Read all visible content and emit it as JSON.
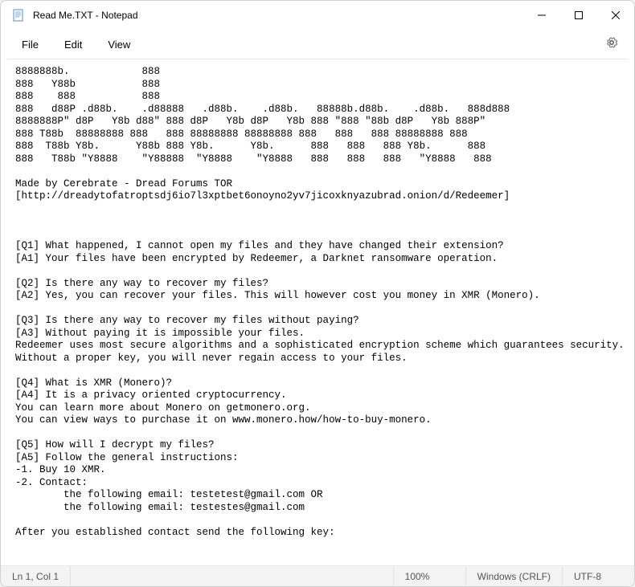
{
  "window": {
    "title": "Read Me.TXT - Notepad"
  },
  "menubar": {
    "file": "File",
    "edit": "Edit",
    "view": "View"
  },
  "content": {
    "text": "8888888b.            888\n888   Y88b           888\n888    888           888\n888   d88P .d88b.    .d88888   .d88b.    .d88b.   88888b.d88b.    .d88b.   888d888\n8888888P\" d8P   Y8b d88\" 888 d8P   Y8b d8P   Y8b 888 \"888 \"88b d8P   Y8b 888P\"\n888 T88b  88888888 888   888 88888888 88888888 888   888   888 88888888 888\n888  T88b Y8b.      Y88b 888 Y8b.      Y8b.      888   888   888 Y8b.      888\n888   T88b \"Y8888    \"Y88888  \"Y8888    \"Y8888   888   888   888   \"Y8888   888\n\nMade by Cerebrate - Dread Forums TOR\n[http://dreadytofatroptsdj6io7l3xptbet6onoyno2yv7jicoxknyazubrad.onion/d/Redeemer]\n\n\n\n[Q1] What happened, I cannot open my files and they have changed their extension?\n[A1] Your files have been encrypted by Redeemer, a Darknet ransomware operation.\n\n[Q2] Is there any way to recover my files?\n[A2] Yes, you can recover your files. This will however cost you money in XMR (Monero).\n\n[Q3] Is there any way to recover my files without paying?\n[A3] Without paying it is impossible your files.\nRedeemer uses most secure algorithms and a sophisticated encryption scheme which guarantees security.\nWithout a proper key, you will never regain access to your files.\n\n[Q4] What is XMR (Monero)?\n[A4] It is a privacy oriented cryptocurrency.\nYou can learn more about Monero on getmonero.org.\nYou can view ways to purchase it on www.monero.how/how-to-buy-monero.\n\n[Q5] How will I decrypt my files?\n[A5] Follow the general instructions:\n-1. Buy 10 XMR.\n-2. Contact:\n        the following email: testetest@gmail.com OR\n        the following email: testestes@gmail.com\n\nAfter you established contact send the following key:"
  },
  "statusbar": {
    "position": "Ln 1, Col 1",
    "zoom": "100%",
    "lineending": "Windows (CRLF)",
    "encoding": "UTF-8"
  }
}
